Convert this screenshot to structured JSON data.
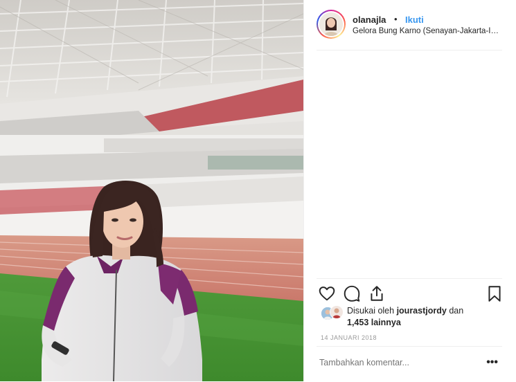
{
  "post": {
    "username": "olanajla",
    "separator": "•",
    "follow_label": "Ikuti",
    "location": "Gelora Bung Karno (Senayan-Jakarta-Indo...",
    "liked_prefix": "Disukai oleh",
    "liked_by": "jourastjordy",
    "liked_joiner": "dan",
    "liked_count": "1,453 lainnya",
    "date": "14 JANUARI 2018",
    "comment_placeholder": "Tambahkan komentar...",
    "more_label": "•••"
  },
  "icons": {
    "like": "heart-icon",
    "comment": "comment-icon",
    "share": "share-icon",
    "save": "bookmark-icon",
    "more": "more-options-icon"
  },
  "colors": {
    "link": "#3897f0",
    "text": "#262626",
    "muted": "#999999",
    "divider": "#efefef"
  }
}
